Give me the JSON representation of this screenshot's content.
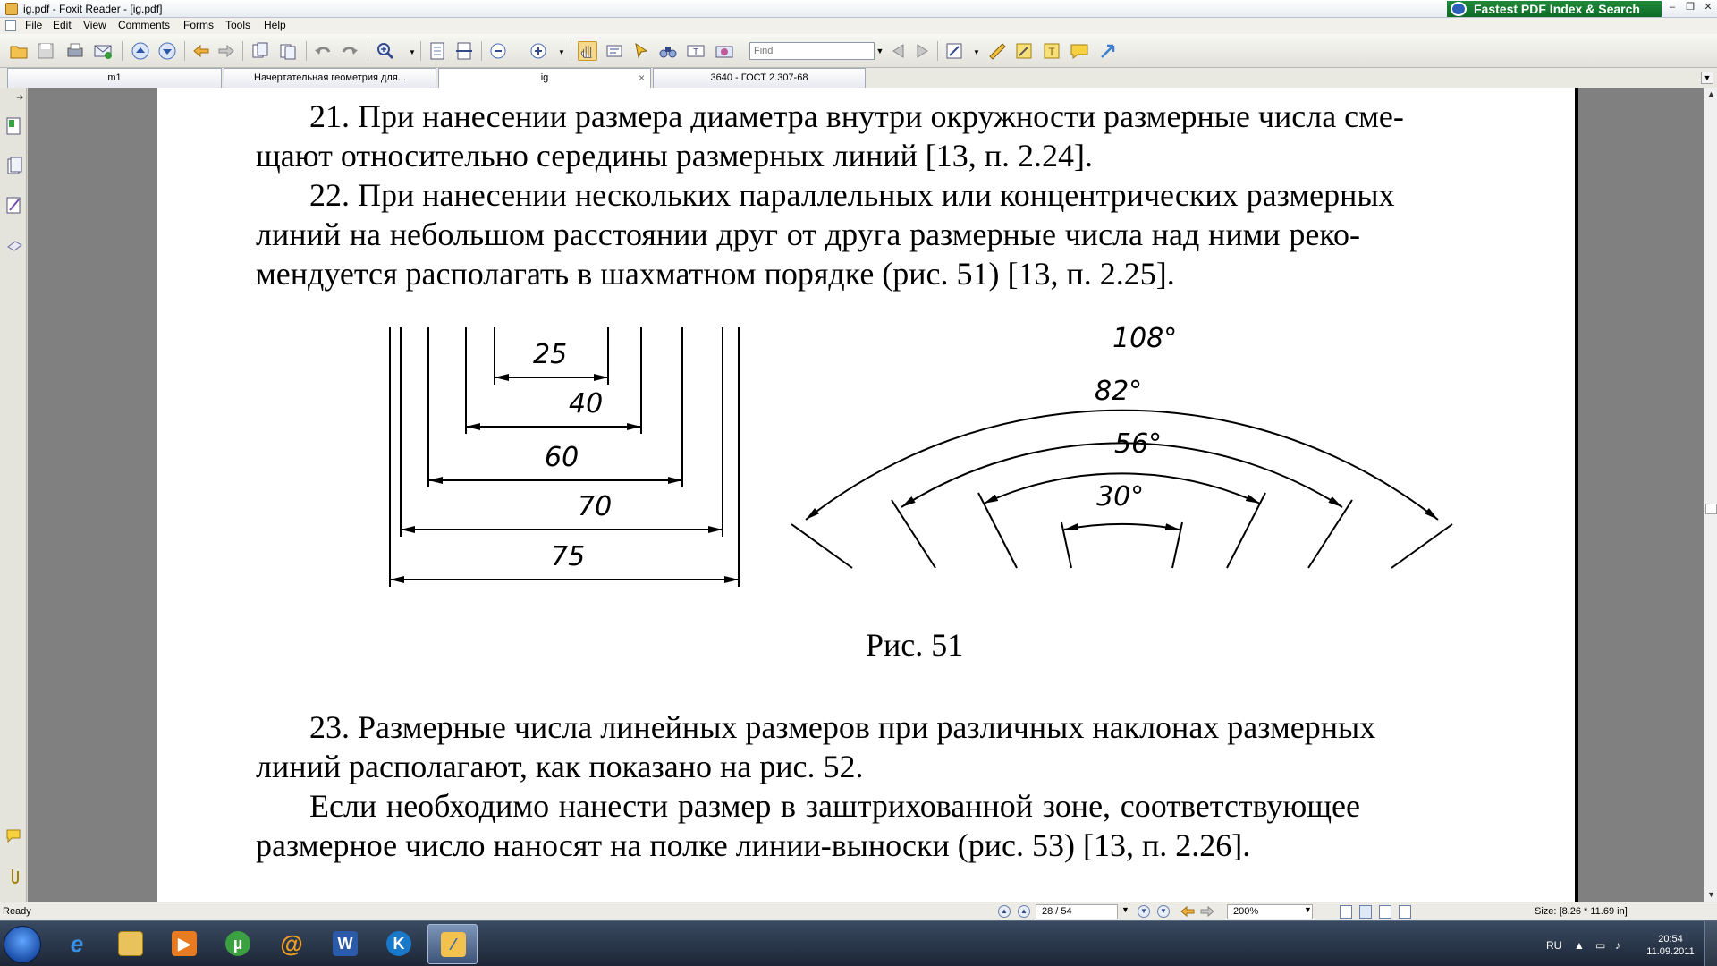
{
  "window": {
    "title": "ig.pdf - Foxit Reader - [ig.pdf]",
    "ad_text": "Fastest PDF Index & Search",
    "min": "–",
    "restore": "❐",
    "close": "✕"
  },
  "menu": [
    "File",
    "Edit",
    "View",
    "Comments",
    "Forms",
    "Tools",
    "Help"
  ],
  "toolbar": {
    "find_placeholder": "Find"
  },
  "tabs": [
    {
      "label": "m1",
      "active": false
    },
    {
      "label": "Начертательная геометрия для...",
      "active": false
    },
    {
      "label": "ig",
      "active": true,
      "close": "×"
    },
    {
      "label": "3640 - ГОСТ 2.307-68",
      "active": false
    }
  ],
  "document": {
    "p21_line1": "21. При нанесении размера диаметра внутри окружности размерные числа сме-",
    "p21_line2": "щают относительно середины размерных линий [13, п. 2.24].",
    "p22_line1": "22. При нанесении нескольких параллельных или концентрических размерных",
    "p22_line2": "линий на небольшом расстоянии друг от друга размерные числа над ними реко-",
    "p22_line3": "мендуется располагать в шахматном порядке (рис. 51) [13, п. 2.25].",
    "figure_caption": "Рис. 51",
    "p23_line1": "23. Размерные числа линейных размеров при различных наклонах размерных",
    "p23_line2": "линий располагают, как показано на рис. 52.",
    "p24_line1": "Если необходимо нанести размер в заштрихованной зоне, соответствующее",
    "p24_line2": "размерное число наносят на полке линии-выноски (рис. 53) [13, п. 2.26].",
    "linear_dims": [
      "25",
      "40",
      "60",
      "70",
      "75"
    ],
    "angular_dims": [
      "108°",
      "82°",
      "56°",
      "30°"
    ]
  },
  "status": {
    "ready": "Ready",
    "page": "28 / 54",
    "zoom": "200%",
    "size": "Size: [8.26 * 11.69 in]"
  },
  "taskbar": {
    "lang": "RU",
    "time": "20:54",
    "date": "11.09.2011"
  },
  "colors": {
    "ad_green": "#1e8a3a",
    "taskbar": "#1c2636"
  }
}
